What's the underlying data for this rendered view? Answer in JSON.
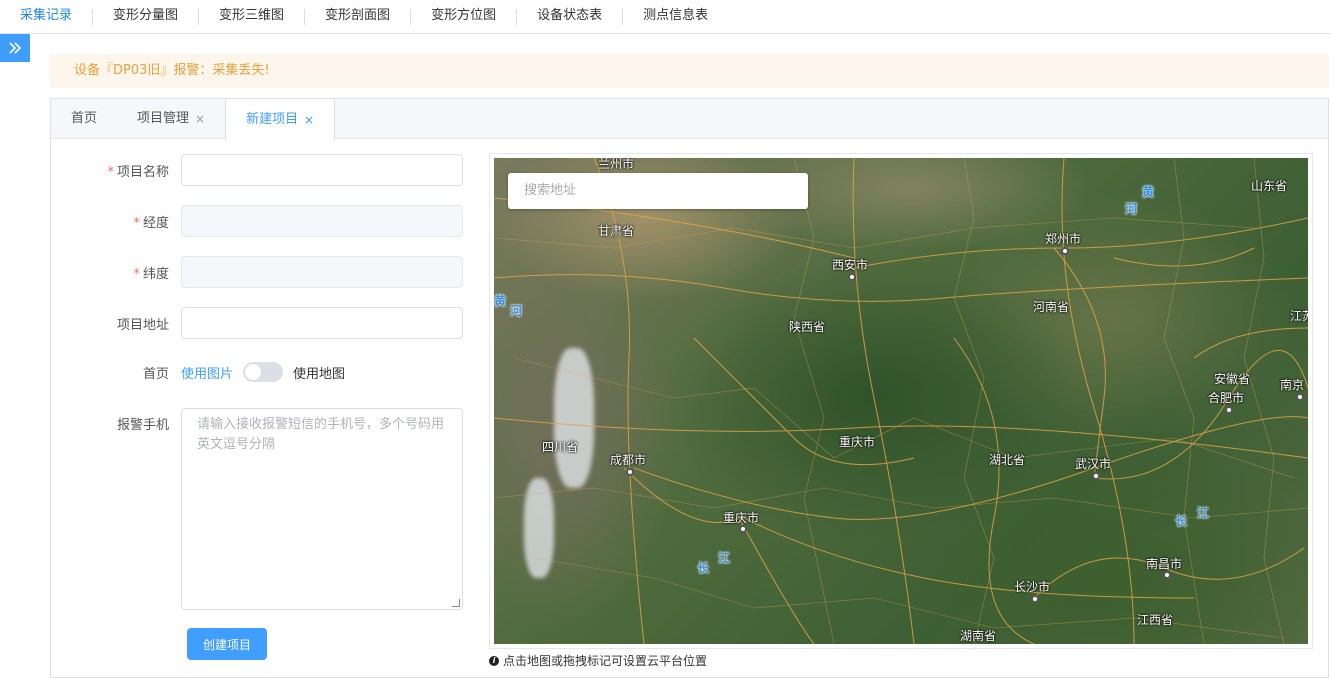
{
  "topnav": {
    "items": [
      "采集记录",
      "变形分量图",
      "变形三维图",
      "变形剖面图",
      "变形方位图",
      "设备状态表",
      "测点信息表"
    ]
  },
  "alert": {
    "text": "设备『DP03旧』报警：采集丢失!"
  },
  "tabs": [
    {
      "label": "首页"
    },
    {
      "label": "项目管理",
      "close": "×"
    },
    {
      "label": "新建项目",
      "close": "×"
    }
  ],
  "form": {
    "name_label": "项目名称",
    "lng_label": "经度",
    "lat_label": "纬度",
    "address_label": "项目地址",
    "home_label": "首页",
    "switch_left": "使用图片",
    "switch_right": "使用地图",
    "phone_label": "报警手机",
    "phone_placeholder": "请输入接收报警短信的手机号，多个号码用英文逗号分隔",
    "submit": "创建项目",
    "required_mark": "*"
  },
  "map": {
    "search_placeholder": "搜索地址",
    "hint": "点击地图或拖拽标记可设置云平台位置",
    "labels": {
      "lanzhou": "兰州市",
      "gansu": "甘肃省",
      "xian": "西安市",
      "zhengzhou": "郑州市",
      "shandong": "山东省",
      "henan": "河南省",
      "shaanxi": "陕西省",
      "jiangsu_partial": "江苏",
      "anhui": "安徽省",
      "hefei": "合肥市",
      "nanjing_partial": "南京",
      "sichuan": "四川省",
      "chongqing_label": "重庆市",
      "hubei": "湖北省",
      "wuhan": "武汉市",
      "chengdu": "成都市",
      "chongqing_city": "重庆市",
      "nanchang": "南昌市",
      "changsha": "长沙市",
      "jiangxi": "江西省",
      "hunan": "湖南省"
    },
    "rivers": {
      "huang1": "黄",
      "he1": "河",
      "huang2": "黄",
      "he2": "河",
      "chang1": "长",
      "jiang1": "江",
      "chang2": "长",
      "jiang2": "江"
    }
  }
}
